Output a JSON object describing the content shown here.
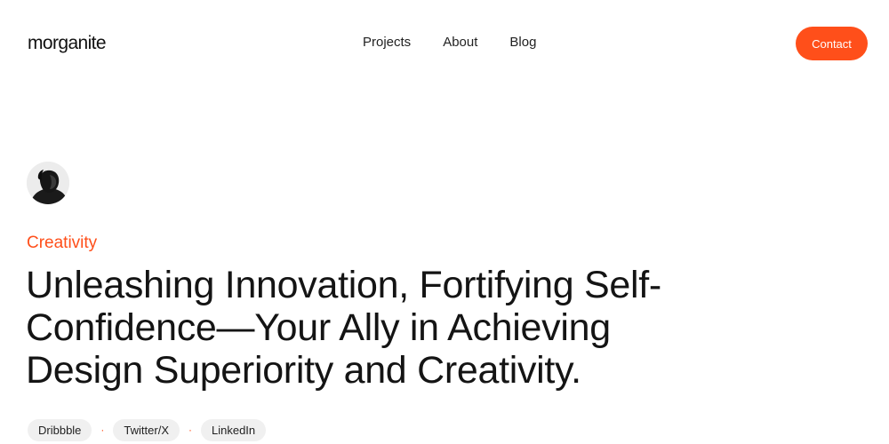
{
  "brand": {
    "name": "morganite",
    "accent_color": "#ff4f1a"
  },
  "nav": {
    "items": [
      {
        "label": "Projects"
      },
      {
        "label": "About"
      },
      {
        "label": "Blog"
      }
    ],
    "contact_label": "Contact"
  },
  "hero": {
    "avatar_icon": "portrait-photo",
    "eyebrow": "Creativity",
    "headline": "Unleashing Innovation, Fortifying Self-Confidence—Your Ally in Achieving Design Superiority and Creativity.",
    "socials": [
      {
        "label": "Dribbble"
      },
      {
        "label": "Twitter/X"
      },
      {
        "label": "LinkedIn"
      }
    ],
    "separator": "·"
  }
}
